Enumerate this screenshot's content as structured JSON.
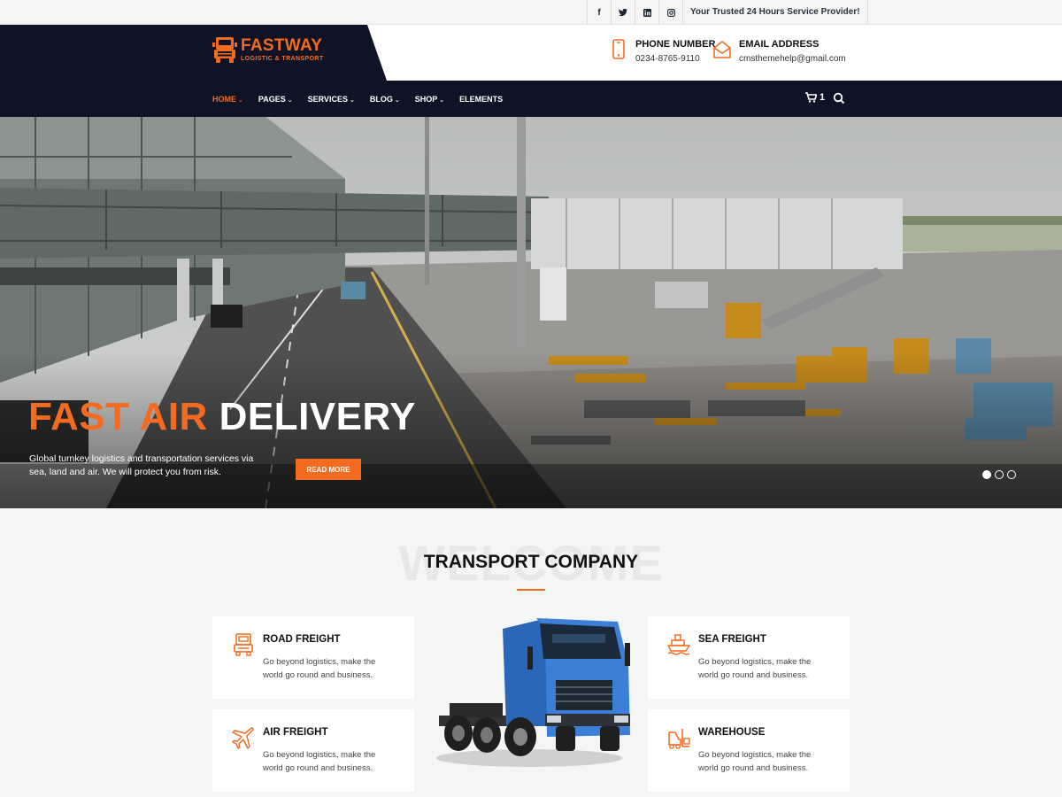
{
  "topbar": {
    "social": [
      {
        "icon": "facebook-icon",
        "glyph": "f"
      },
      {
        "icon": "twitter-icon",
        "glyph": "t"
      },
      {
        "icon": "linkedin-icon",
        "glyph": "in"
      },
      {
        "icon": "instagram-icon",
        "glyph": "◎"
      }
    ],
    "tagline": "Your Trusted 24 Hours Service Provider!"
  },
  "brand": {
    "name": "FASTWAY",
    "subtitle": "LOGISTIC & TRANSPORT",
    "accent_color": "#f36b21",
    "navy_color": "#0e1426"
  },
  "contact": {
    "phone_label": "PHONE NUMBER",
    "phone_value": "0234-8765-9110",
    "email_label": "EMAIL ADDRESS",
    "email_value": "cmsthemehelp@gmail.com"
  },
  "nav": {
    "items": [
      {
        "label": "HOME",
        "active": true
      },
      {
        "label": "PAGES"
      },
      {
        "label": "SERVICES"
      },
      {
        "label": "BLOG"
      },
      {
        "label": "SHOP"
      },
      {
        "label": "ELEMENTS"
      }
    ],
    "cart_count": "1"
  },
  "hero": {
    "title_accent": "FAST AIR",
    "title_rest": "DELIVERY",
    "subtitle": "Global turnkey logistics and transportation services via sea, land and air. We will protect you from risk.",
    "button": "READ MORE",
    "slides": 3,
    "active_slide": 1
  },
  "welcome": {
    "watermark": "WELCOME",
    "title": "TRANSPORT COMPANY"
  },
  "services": [
    {
      "title": "ROAD FREIGHT",
      "text": "Go beyond logistics, make the world go round and business.",
      "icon": "truck-icon"
    },
    {
      "title": "AIR FREIGHT",
      "text": "Go beyond logistics, make the world go round and business.",
      "icon": "airplane-icon"
    },
    {
      "title": "SEA FREIGHT",
      "text": "Go beyond logistics, make the world go round and business.",
      "icon": "ship-icon"
    },
    {
      "title": "WAREHOUSE",
      "text": "Go beyond logistics, make the world go round and business.",
      "icon": "forklift-icon"
    }
  ]
}
